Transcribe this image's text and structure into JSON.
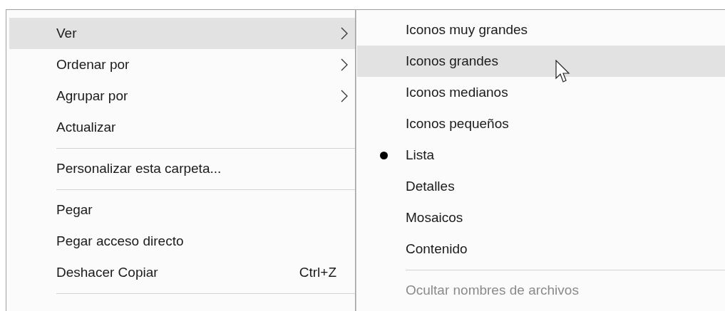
{
  "context_menu": {
    "items": [
      {
        "kind": "item",
        "label": "Ver",
        "submenu": true,
        "selected": true
      },
      {
        "kind": "item",
        "label": "Ordenar por",
        "submenu": true,
        "selected": false
      },
      {
        "kind": "item",
        "label": "Agrupar por",
        "submenu": true,
        "selected": false
      },
      {
        "kind": "item",
        "label": "Actualizar",
        "submenu": false,
        "selected": false
      },
      {
        "kind": "separator"
      },
      {
        "kind": "item",
        "label": "Personalizar esta carpeta...",
        "submenu": false,
        "selected": false
      },
      {
        "kind": "separator"
      },
      {
        "kind": "item",
        "label": "Pegar",
        "submenu": false,
        "selected": false
      },
      {
        "kind": "item",
        "label": "Pegar acceso directo",
        "submenu": false,
        "selected": false
      },
      {
        "kind": "item",
        "label": "Deshacer Copiar",
        "shortcut": "Ctrl+Z",
        "submenu": false,
        "selected": false
      },
      {
        "kind": "separator"
      }
    ]
  },
  "submenu": {
    "items": [
      {
        "kind": "radio",
        "label": "Iconos muy grandes",
        "checked": false,
        "selected": false
      },
      {
        "kind": "radio",
        "label": "Iconos grandes",
        "checked": false,
        "selected": true
      },
      {
        "kind": "radio",
        "label": "Iconos medianos",
        "checked": false,
        "selected": false
      },
      {
        "kind": "radio",
        "label": "Iconos pequeños",
        "checked": false,
        "selected": false
      },
      {
        "kind": "radio",
        "label": "Lista",
        "checked": true,
        "selected": false
      },
      {
        "kind": "radio",
        "label": "Detalles",
        "checked": false,
        "selected": false
      },
      {
        "kind": "radio",
        "label": "Mosaicos",
        "checked": false,
        "selected": false
      },
      {
        "kind": "radio",
        "label": "Contenido",
        "checked": false,
        "selected": false
      },
      {
        "kind": "separator"
      },
      {
        "kind": "item",
        "label": "Ocultar nombres de archivos",
        "disabled": true,
        "selected": false
      }
    ]
  }
}
